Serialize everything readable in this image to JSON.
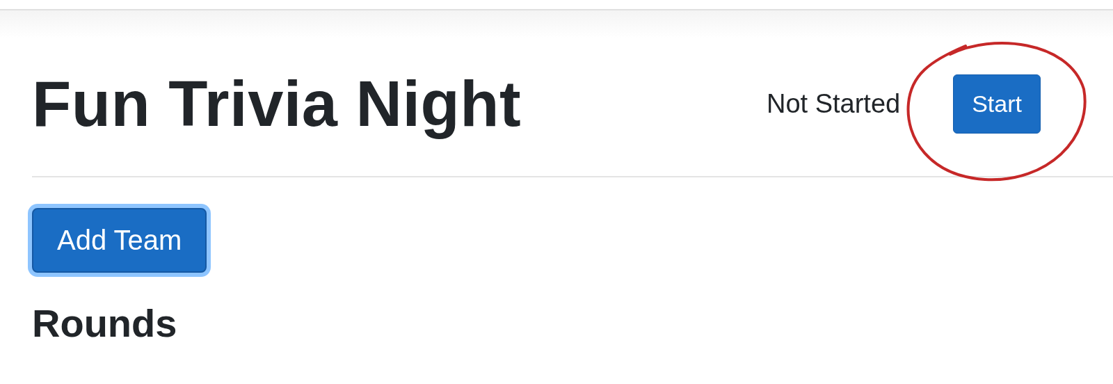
{
  "header": {
    "title": "Fun Trivia Night",
    "status": "Not Started",
    "start_button": "Start"
  },
  "annotation": {
    "kind": "circle"
  },
  "add_team_button": {
    "label": "Add Team",
    "focused": true
  },
  "section_heading": "Rounds"
}
